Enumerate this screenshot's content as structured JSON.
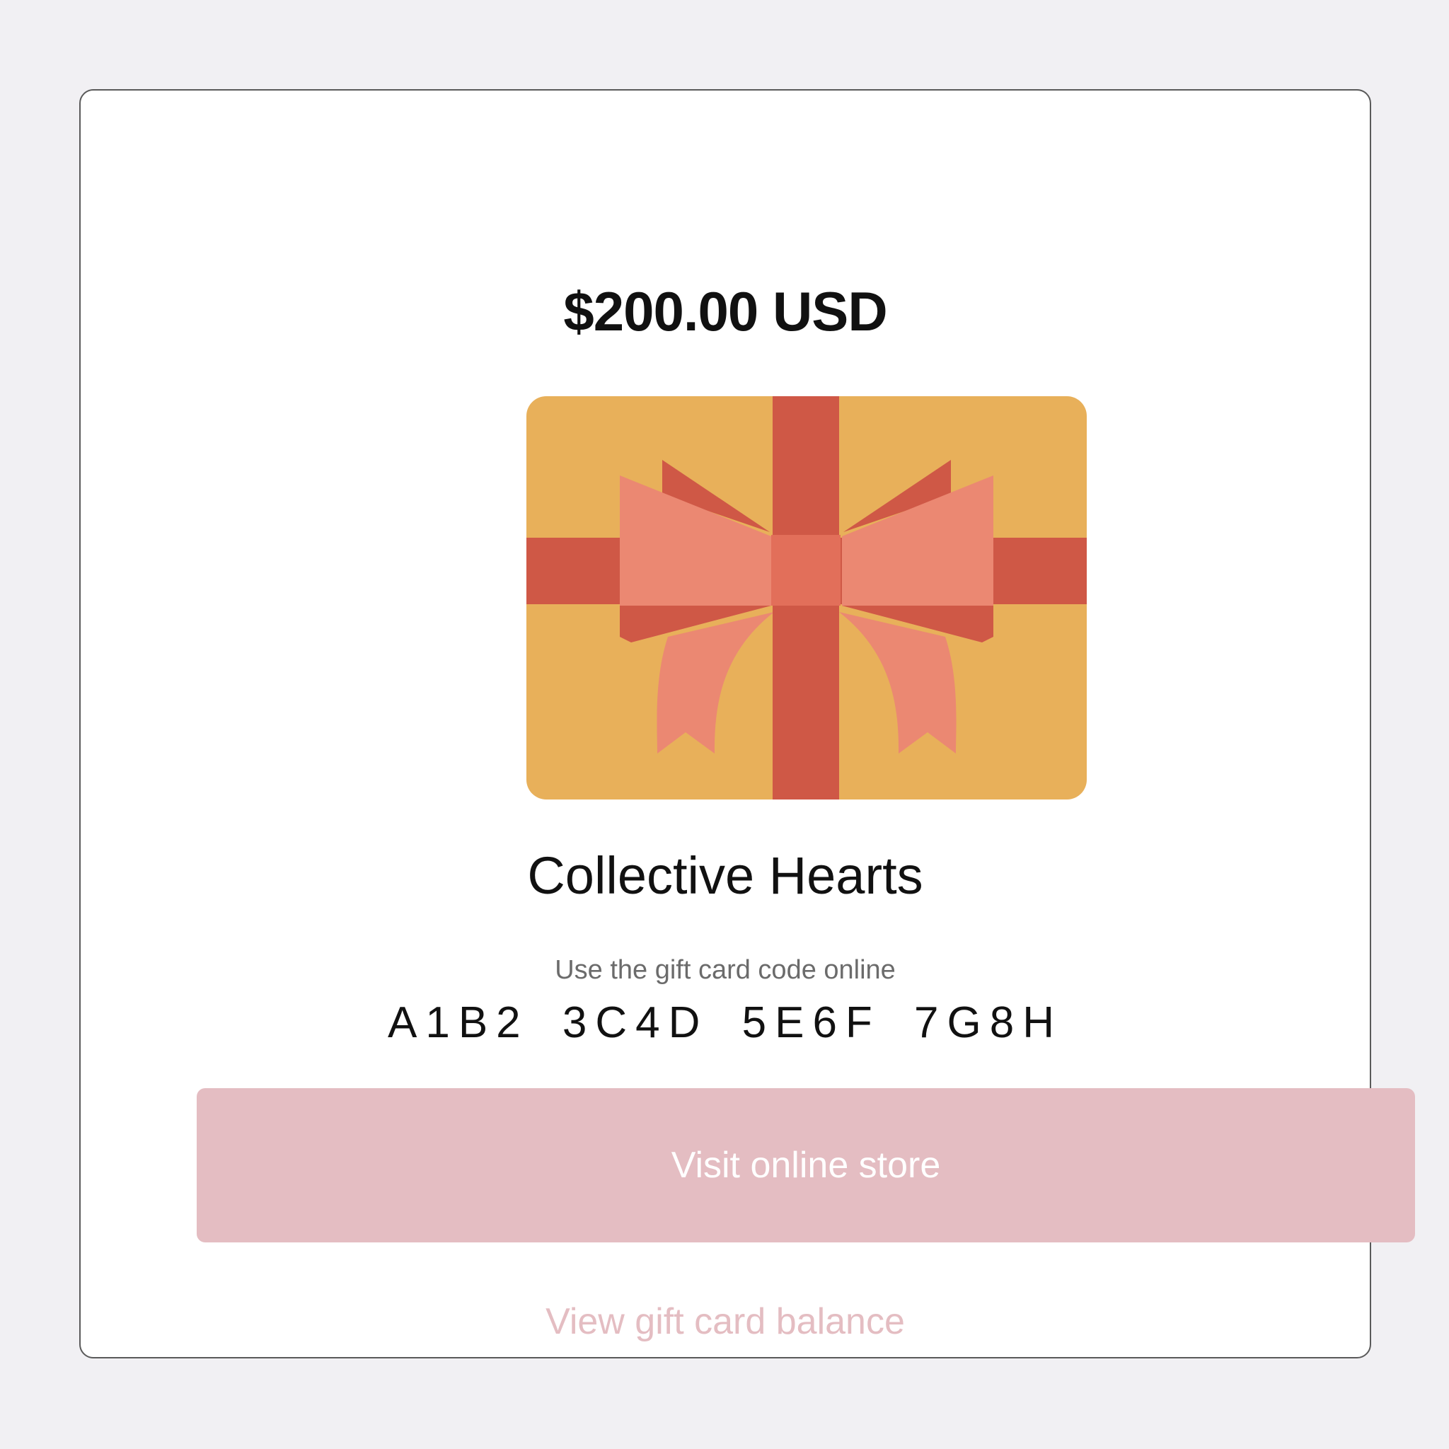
{
  "gift_card": {
    "amount": "$200.00 USD",
    "image_icon": "gift-card-bow-icon",
    "merchant_name": "Collective Hearts",
    "code_hint": "Use the gift card code online",
    "code": "A1B2 3C4D 5E6F 7G8H"
  },
  "actions": {
    "visit_store_label": "Visit online store",
    "view_balance_label": "View gift card balance"
  },
  "colors": {
    "page_background": "#f1f0f3",
    "card_background": "#ffffff",
    "gift_gold": "#e8b05a",
    "ribbon_red": "#cf5846",
    "bow_salmon": "#eb8872",
    "button_pink": "#e4bdc2"
  }
}
